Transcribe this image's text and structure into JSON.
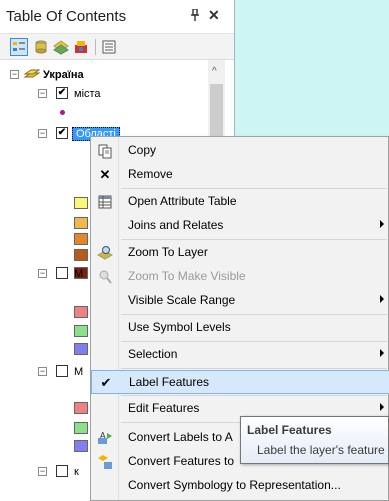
{
  "panel": {
    "title": "Table Of Contents",
    "pin_glyph": "❘",
    "close_glyph": "✕"
  },
  "toolbar": {
    "buttons": [
      {
        "name": "list-by-drawing-order",
        "active": true
      },
      {
        "name": "list-by-source"
      },
      {
        "name": "list-by-visibility"
      },
      {
        "name": "list-by-selection"
      },
      {
        "name": "options"
      }
    ]
  },
  "tree": {
    "root": {
      "label": "Україна",
      "expanded": true
    },
    "layers": [
      {
        "label": "міста",
        "checked": true,
        "expanded": true
      },
      {
        "label": "Області",
        "checked": true,
        "expanded": true,
        "selected": true
      },
      {
        "label": "M",
        "checked": false,
        "expanded": true
      },
      {
        "label": "M",
        "checked": false,
        "expanded": true
      },
      {
        "label": "к",
        "checked": false,
        "expanded": true
      }
    ],
    "symbol_colors": [
      "#f7f77a",
      "#f0b84d",
      "#e2872e",
      "#b85a18",
      "#7a1f0a",
      "#f08080",
      "#8ce08c",
      "#7f7fef",
      "#f08080",
      "#8ce08c",
      "#7f7fef"
    ]
  },
  "context_menu": {
    "items": [
      {
        "label": "Copy",
        "icon": "copy-icon"
      },
      {
        "label": "Remove",
        "icon": "remove-icon"
      },
      {
        "label": "Open Attribute Table",
        "icon": "table-icon"
      },
      {
        "label": "Joins and Relates",
        "submenu": true
      },
      {
        "label": "Zoom To Layer",
        "icon": "zoom-layer-icon"
      },
      {
        "label": "Zoom To Make Visible",
        "icon": "zoom-visible-icon",
        "disabled": true
      },
      {
        "label": "Visible Scale Range",
        "submenu": true
      },
      {
        "label": "Use Symbol Levels"
      },
      {
        "label": "Selection",
        "submenu": true
      },
      {
        "label": "Label Features",
        "checked": true,
        "highlighted": true
      },
      {
        "label": "Edit Features",
        "submenu": true
      },
      {
        "label": "Convert Labels to A",
        "icon": "convert-labels-icon"
      },
      {
        "label": "Convert Features to",
        "icon": "convert-features-icon"
      },
      {
        "label": "Convert Symbology to Representation...",
        "icon": ""
      }
    ]
  },
  "tooltip": {
    "title": "Label Features",
    "body": "Label the layer's feature"
  }
}
